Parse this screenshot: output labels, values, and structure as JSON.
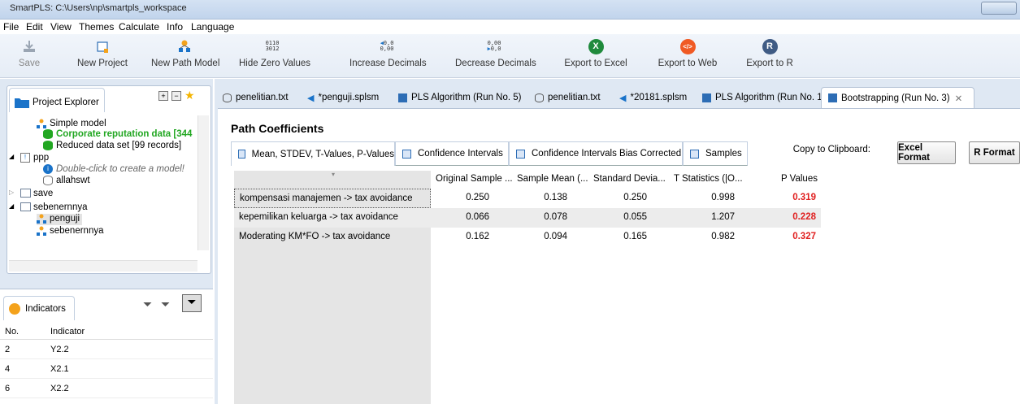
{
  "window": {
    "title": "SmartPLS: C:\\Users\\np\\smartpls_workspace"
  },
  "menu": [
    "File",
    "Edit",
    "View",
    "Themes",
    "Calculate",
    "Info",
    "Language"
  ],
  "toolbar": {
    "save": "Save",
    "new_project": "New Project",
    "new_path_model": "New Path Model",
    "hide_zero_values": "Hide Zero Values",
    "increase_decimals": "Increase Decimals",
    "decrease_decimals": "Decrease Decimals",
    "export_excel": "Export to Excel",
    "export_web": "Export to Web",
    "export_r": "Export to R",
    "hide_zero_icon_top": "0110",
    "hide_zero_icon_bottom": "3012",
    "inc_dec_icon_top": "0,0",
    "inc_dec_icon_bottom": "0,00",
    "dec_dec_icon_top": "0,00",
    "dec_dec_icon_bottom": "0,0",
    "excel_glyph": "X",
    "web_glyph": "</>",
    "r_glyph": "R"
  },
  "project_explorer": {
    "title": "Project Explorer",
    "items": [
      {
        "label": "Simple model",
        "kind": "model"
      },
      {
        "label": "Corporate reputation data [344",
        "kind": "data-active"
      },
      {
        "label": "Reduced data set [99 records]",
        "kind": "data"
      },
      {
        "label": "ppp",
        "kind": "project"
      },
      {
        "label": "Double-click to create a model!",
        "kind": "hint"
      },
      {
        "label": "allahswt",
        "kind": "data-grey"
      },
      {
        "label": "save",
        "kind": "project-collapsed"
      },
      {
        "label": "sebenernnya",
        "kind": "project"
      },
      {
        "label": "penguji",
        "kind": "model-selected"
      },
      {
        "label": "sebenernnya",
        "kind": "model"
      }
    ]
  },
  "indicators": {
    "title": "Indicators",
    "columns": [
      "No.",
      "Indicator"
    ],
    "rows": [
      {
        "no": "2",
        "indicator": "Y2.2"
      },
      {
        "no": "4",
        "indicator": "X2.1"
      },
      {
        "no": "6",
        "indicator": "X2.2"
      }
    ]
  },
  "editor_tabs": [
    {
      "label": "penelitian.txt",
      "icon": "db"
    },
    {
      "label": "*penguji.splsm",
      "icon": "model"
    },
    {
      "label": "PLS Algorithm (Run No. 5)",
      "icon": "grid"
    },
    {
      "label": "penelitian.txt",
      "icon": "db"
    },
    {
      "label": "*20181.splsm",
      "icon": "model"
    },
    {
      "label": "PLS Algorithm (Run No. 1)",
      "icon": "grid"
    },
    {
      "label": "Bootstrapping (Run No. 3)",
      "icon": "grid",
      "active": true
    }
  ],
  "report": {
    "section_title": "Path Coefficients",
    "subtabs": [
      "Mean, STDEV, T-Values, P-Values",
      "Confidence Intervals",
      "Confidence Intervals Bias Corrected",
      "Samples"
    ],
    "copy_label": "Copy to Clipboard:",
    "excel_format": "Excel Format",
    "r_format": "R Format",
    "columns": [
      "Original Sample ...",
      "Sample Mean (...",
      "Standard Devia...",
      "T Statistics (|O...",
      "P Values"
    ],
    "rows": [
      {
        "label": "kompensasi manajemen -> tax avoidance",
        "values": [
          "0.250",
          "0.138",
          "0.250",
          "0.998",
          "0.319"
        ]
      },
      {
        "label": "kepemilikan keluarga -> tax avoidance",
        "values": [
          "0.066",
          "0.078",
          "0.055",
          "1.207",
          "0.228"
        ]
      },
      {
        "label": "Moderating KM*FO -> tax avoidance",
        "values": [
          "0.162",
          "0.094",
          "0.165",
          "0.982",
          "0.327"
        ]
      }
    ]
  },
  "colors": {
    "accent": "#1a73c9",
    "p_value": "#e02020",
    "active_data": "#22a722"
  }
}
